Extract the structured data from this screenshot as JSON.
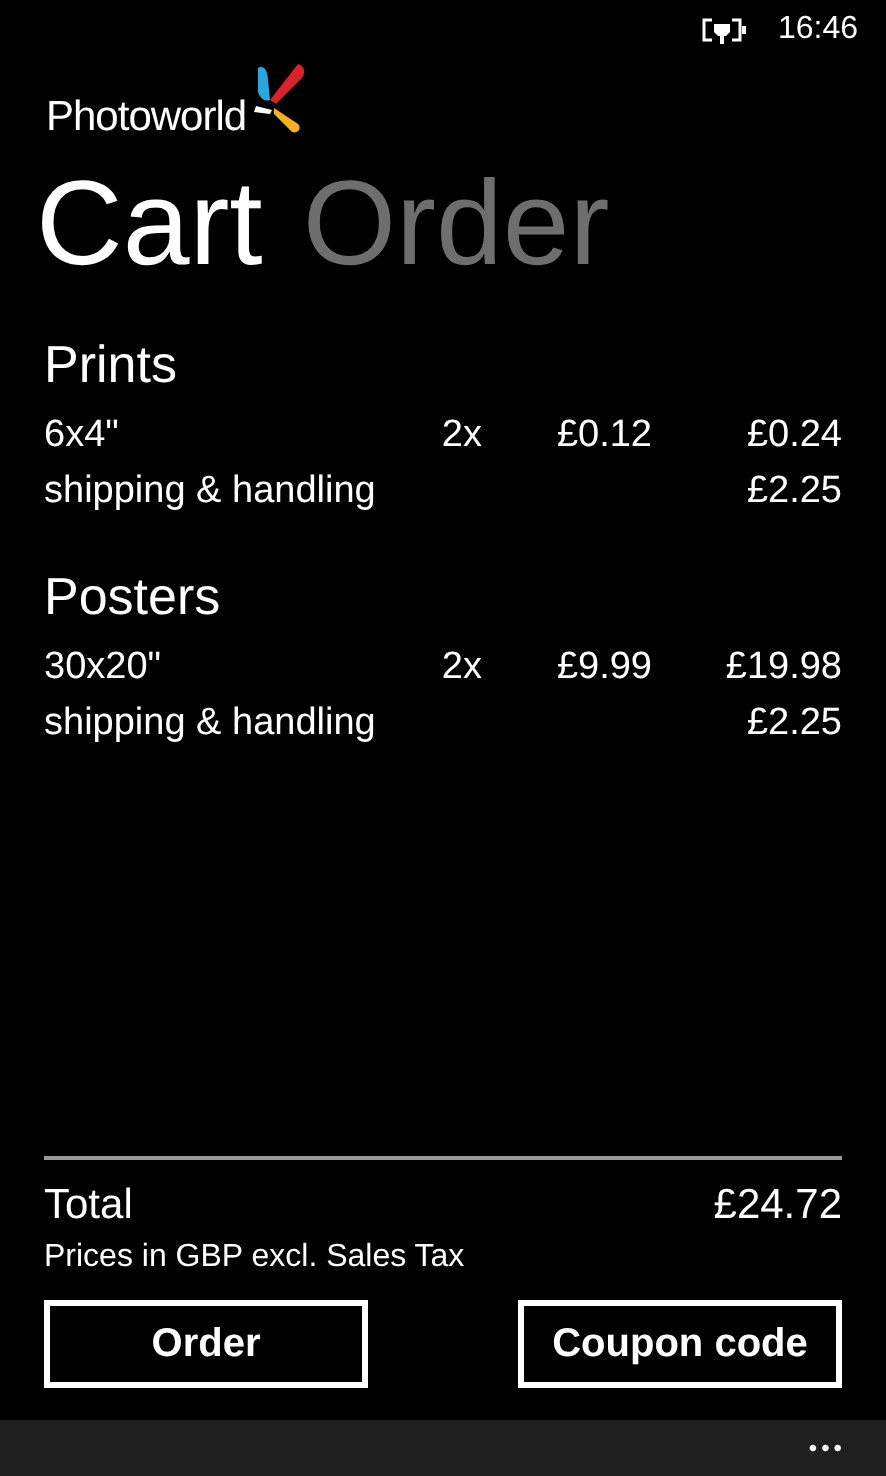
{
  "status_bar": {
    "time": "16:46"
  },
  "app": {
    "name": "Photoworld"
  },
  "tabs": [
    {
      "label": "Cart",
      "selected": true
    },
    {
      "label": "Order",
      "selected": false
    }
  ],
  "sections": [
    {
      "title": "Prints",
      "items": [
        {
          "name": "6x4\"",
          "quantity": "2x",
          "unit_price": "£0.12",
          "total": "£0.24"
        },
        {
          "name": "shipping & handling",
          "total": "£2.25"
        }
      ]
    },
    {
      "title": "Posters",
      "items": [
        {
          "name": "30x20\"",
          "quantity": "2x",
          "unit_price": "£9.99",
          "total": "£19.98"
        },
        {
          "name": "shipping & handling",
          "total": "£2.25"
        }
      ]
    }
  ],
  "total": {
    "label": "Total",
    "value": "£24.72",
    "note": "Prices in GBP excl. Sales Tax"
  },
  "buttons": [
    "Order",
    "Coupon code"
  ],
  "app_bar": {
    "more": "•••"
  }
}
